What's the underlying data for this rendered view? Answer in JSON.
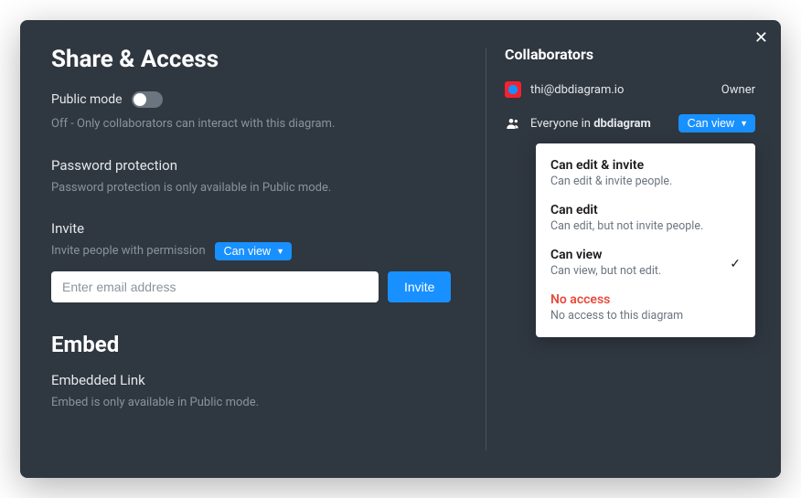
{
  "modal": {
    "title": "Share & Access",
    "public_mode": {
      "label": "Public mode",
      "helper": "Off - Only collaborators can interact with this diagram."
    },
    "password": {
      "heading": "Password protection",
      "helper": "Password protection is only available in Public mode."
    },
    "invite": {
      "heading": "Invite",
      "perm_label": "Invite people with permission",
      "perm_value": "Can view",
      "email_placeholder": "Enter email address",
      "button": "Invite"
    },
    "embed": {
      "title": "Embed",
      "link_heading": "Embedded Link",
      "helper": "Embed is only available in Public mode."
    }
  },
  "collaborators": {
    "title": "Collaborators",
    "items": [
      {
        "name": "thi@dbdiagram.io",
        "role": "Owner"
      },
      {
        "name_prefix": "Everyone in ",
        "name_bold": "dbdiagram",
        "perm": "Can view"
      }
    ]
  },
  "perm_options": [
    {
      "title": "Can edit & invite",
      "desc": "Can edit & invite people.",
      "selected": false,
      "danger": false
    },
    {
      "title": "Can edit",
      "desc": "Can edit, but not invite people.",
      "selected": false,
      "danger": false
    },
    {
      "title": "Can view",
      "desc": "Can view, but not edit.",
      "selected": true,
      "danger": false
    },
    {
      "title": "No access",
      "desc": "No access to this diagram",
      "selected": false,
      "danger": true
    }
  ]
}
